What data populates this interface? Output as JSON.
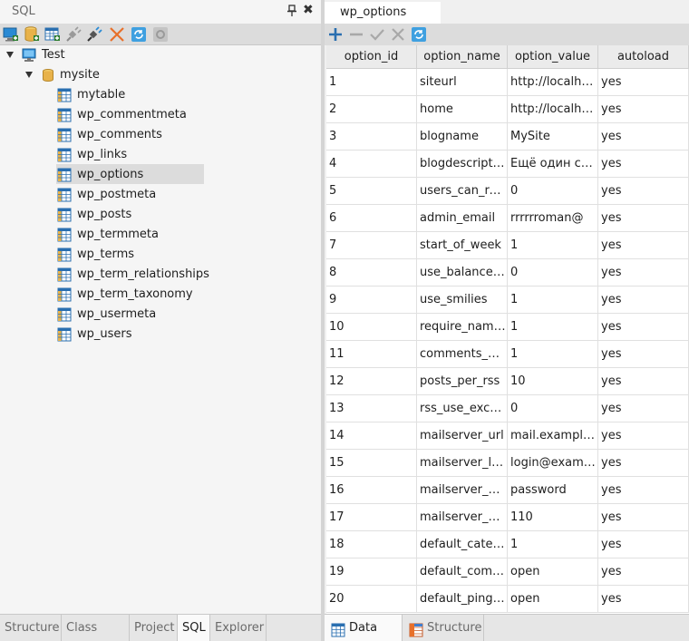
{
  "left_panel": {
    "title": "SQL",
    "close_glyph": "✖",
    "toolbar_icons": [
      "new-connection-icon",
      "new-database-icon",
      "new-table-icon",
      "disconnect-icon",
      "connect-icon",
      "delete-icon",
      "refresh-icon",
      "settings-icon"
    ],
    "tree": {
      "connection": "Test",
      "database": "mysite",
      "tables": [
        "mytable",
        "wp_commentmeta",
        "wp_comments",
        "wp_links",
        "wp_options",
        "wp_postmeta",
        "wp_posts",
        "wp_termmeta",
        "wp_terms",
        "wp_term_relationships",
        "wp_term_taxonomy",
        "wp_usermeta",
        "wp_users"
      ],
      "selected": "wp_options"
    },
    "tabs": [
      "Structure",
      "Class View",
      "Project",
      "SQL",
      "Explorer"
    ],
    "active_tab": "SQL"
  },
  "right_panel": {
    "doc_tab": "wp_options",
    "toolbar_icons": [
      "add-row-icon",
      "remove-row-icon",
      "apply-icon",
      "cancel-icon",
      "refresh-icon"
    ],
    "columns": [
      "option_id",
      "option_name",
      "option_value",
      "autoload"
    ],
    "rows": [
      [
        "1",
        "siteurl",
        "http://localhost",
        "yes"
      ],
      [
        "2",
        "home",
        "http://localhost",
        "yes"
      ],
      [
        "3",
        "blogname",
        "MySite",
        "yes"
      ],
      [
        "4",
        "blogdescription",
        "Ещё один сайт",
        "yes"
      ],
      [
        "5",
        "users_can_register",
        "0",
        "yes"
      ],
      [
        "6",
        "admin_email",
        "rrrrrroman@",
        "yes"
      ],
      [
        "7",
        "start_of_week",
        "1",
        "yes"
      ],
      [
        "8",
        "use_balanceTags",
        "0",
        "yes"
      ],
      [
        "9",
        "use_smilies",
        "1",
        "yes"
      ],
      [
        "10",
        "require_name_email",
        "1",
        "yes"
      ],
      [
        "11",
        "comments_notify",
        "1",
        "yes"
      ],
      [
        "12",
        "posts_per_rss",
        "10",
        "yes"
      ],
      [
        "13",
        "rss_use_excerpt",
        "0",
        "yes"
      ],
      [
        "14",
        "mailserver_url",
        "mail.example.com",
        "yes"
      ],
      [
        "15",
        "mailserver_login",
        "login@example.com",
        "yes"
      ],
      [
        "16",
        "mailserver_pass",
        "password",
        "yes"
      ],
      [
        "17",
        "mailserver_port",
        "110",
        "yes"
      ],
      [
        "18",
        "default_category",
        "1",
        "yes"
      ],
      [
        "19",
        "default_comment_status",
        "open",
        "yes"
      ],
      [
        "20",
        "default_ping_status",
        "open",
        "yes"
      ]
    ],
    "bottom_tabs": [
      "Data",
      "Structure"
    ],
    "active_bottom_tab": "Data"
  },
  "colors": {
    "toolbar_bg": "#dcdcdc",
    "selection_bg": "#dcdcdc",
    "monitor_blue": "#2a8ad4",
    "db_gold": "#e8b24a",
    "delete_orange": "#e8702a"
  }
}
